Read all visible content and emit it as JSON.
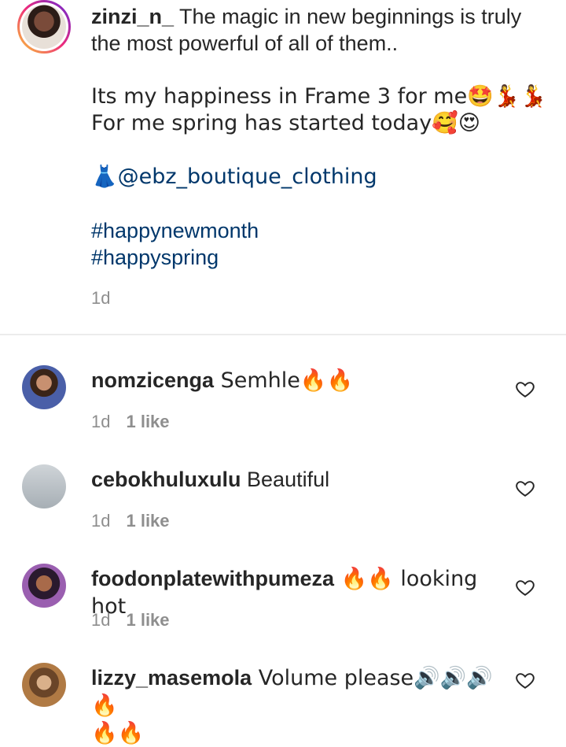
{
  "post": {
    "username": "zinzi_n_",
    "caption_line1": " The magic in new beginnings is truly",
    "caption_line2": "the most powerful of all of them..",
    "caption_line3": "Its my happiness in Frame 3 for me🤩💃💃",
    "caption_line4": "For me spring has started today🥰😍",
    "mention": "👗@ebz_boutique_clothing",
    "hashtag1": "#happynewmonth",
    "hashtag2": "#happyspring",
    "time": "1d"
  },
  "comments": [
    {
      "username": "nomzicenga",
      "text": " Semhle🔥🔥",
      "time": "1d",
      "likes": "1 like",
      "avatar_color": "#6b4a3a"
    },
    {
      "username": "cebokhuluxulu",
      "text": " Beautiful",
      "time": "1d",
      "likes": "1 like",
      "avatar_color": "#8f98a0"
    },
    {
      "username": "foodonplatewithpumeza",
      "text": " 🔥🔥 looking hot",
      "time": "1d",
      "likes": "1 like",
      "avatar_color": "#7a3f8f"
    },
    {
      "username": "lizzy_masemola",
      "text": " Volume please🔊🔊🔊🔥",
      "text2": "🔥🔥",
      "avatar_color": "#8a5a34"
    }
  ]
}
